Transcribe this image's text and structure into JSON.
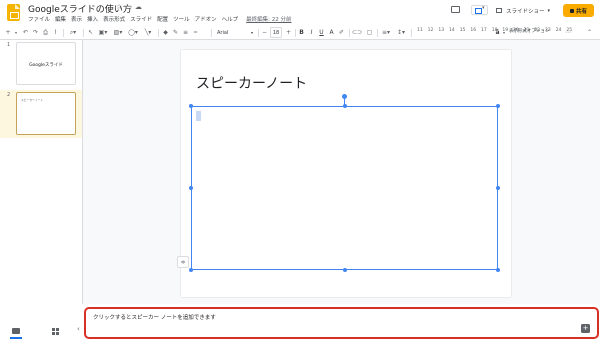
{
  "app": {
    "doc_title": "Googleスライドの使い方",
    "title_icons": [
      "star-icon",
      "folder-icon",
      "cloud-icon"
    ],
    "menu": [
      "ファイル",
      "編集",
      "表示",
      "挿入",
      "表示形式",
      "スライド",
      "配置",
      "ツール",
      "アドオン",
      "ヘルプ"
    ],
    "last_edit": "最終編集: 22 分前",
    "slideshow_label": "スライドショー",
    "share_label": "共有"
  },
  "toolbar": {
    "font_name": "Arial",
    "font_size": "18",
    "ruler": [
      "11",
      "12",
      "13",
      "14",
      "15",
      "16",
      "17",
      "18",
      "19",
      "20",
      "21",
      "22",
      "23",
      "24",
      "25"
    ],
    "format_options": "表示形式オプション"
  },
  "filmstrip": {
    "slides": [
      {
        "number": "1",
        "title": "Googleスライド"
      },
      {
        "number": "2",
        "title": "スピーカーノート"
      }
    ]
  },
  "slide": {
    "title": "スピーカーノート"
  },
  "notes": {
    "placeholder": "クリックするとスピーカー ノートを追加できます"
  },
  "colors": {
    "accent_yellow": "#f9ab00",
    "selection_blue": "#4285f4",
    "notes_border_red": "#d93025",
    "active_slide_bg": "#fef7e0"
  }
}
